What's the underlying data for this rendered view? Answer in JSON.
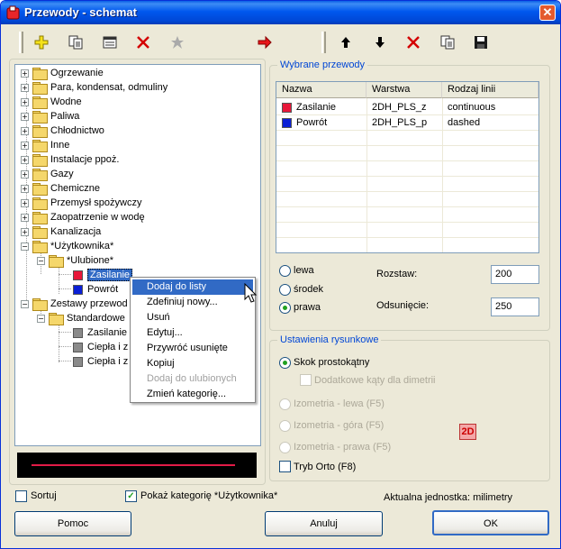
{
  "window": {
    "title": "Przewody - schemat"
  },
  "toolbar": {
    "buttons": [
      "add-icon",
      "copy-icon",
      "properties-icon",
      "delete-icon",
      "favorite-icon",
      "transfer-right-icon",
      "move-up-icon",
      "move-down-icon",
      "remove-icon",
      "copy2-icon",
      "save-icon"
    ]
  },
  "tree": {
    "items": [
      "Ogrzewanie",
      "Para, kondensat, odmuliny",
      "Wodne",
      "Paliwa",
      "Chłodnictwo",
      "Inne",
      "Instalacje ppoż.",
      "Gazy",
      "Chemiczne",
      "Przemysł spożywczy",
      "Zaopatrzenie w wodę",
      "Kanalizacja",
      "*Użytkownika*",
      "*Ulubione*",
      "Zasilanie",
      "Powrót",
      "Zestawy przewod",
      "Standardowe",
      "Zasilanie",
      "Ciepła i z",
      "Ciepła i z"
    ],
    "colors": {
      "zasilanie": "#e8173a",
      "powrot": "#0a1fd6",
      "gray": "#8a8a8a"
    }
  },
  "context_menu": {
    "items": [
      "Dodaj do listy",
      "Zdefiniuj nowy...",
      "Usuń",
      "Edytuj...",
      "Przywróć usunięte",
      "Kopiuj",
      "Dodaj do ulubionych",
      "Zmień kategorię..."
    ]
  },
  "selected": {
    "legend": "Wybrane przewody",
    "headers": [
      "Nazwa",
      "Warstwa",
      "Rodzaj linii"
    ],
    "rows": [
      {
        "name": "Zasilanie",
        "layer": "2DH_PLS_z",
        "line": "continuous",
        "color": "#e8173a"
      },
      {
        "name": "Powrót",
        "layer": "2DH_PLS_p",
        "line": "dashed",
        "color": "#0a1fd6"
      }
    ]
  },
  "placement": {
    "options": [
      "lewa",
      "środek",
      "prawa"
    ],
    "selected": "prawa",
    "rozstaw_label": "Rozstaw:",
    "rozstaw_value": "200",
    "odsuniecie_label": "Odsunięcie:",
    "odsuniecie_value": "250"
  },
  "drawing": {
    "legend": "Ustawienia rysunkowe",
    "skok": "Skok prostokątny",
    "dodatkowe": "Dodatkowe kąty dla dimetrii",
    "izo_lewa": "Izometria - lewa (F5)",
    "izo_gora": "Izometria - góra (F5)",
    "izo_prawa": "Izometria - prawa (F5)",
    "orto": "Tryb Orto (F8)",
    "badge": "2D"
  },
  "footer": {
    "sortuj": "Sortuj",
    "pokaz": "Pokaż kategorię *Użytkownika*",
    "unit": "Aktualna jednostka: milimetry",
    "pomoc": "Pomoc",
    "anuluj": "Anuluj",
    "ok": "OK"
  }
}
